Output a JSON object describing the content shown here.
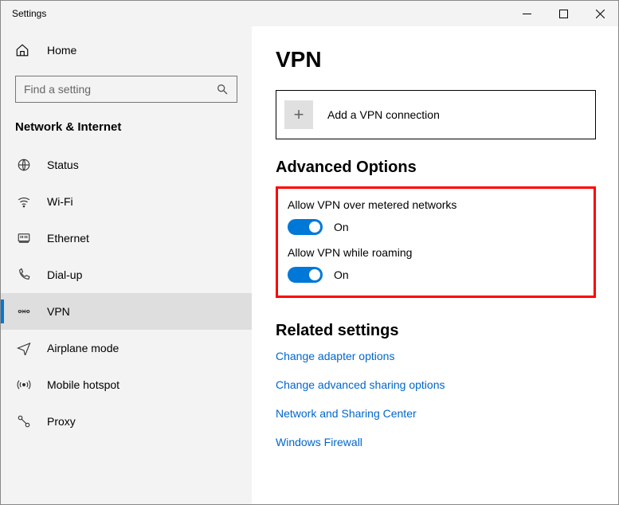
{
  "window": {
    "title": "Settings"
  },
  "sidebar": {
    "home": "Home",
    "search_placeholder": "Find a setting",
    "category": "Network & Internet",
    "items": [
      {
        "label": "Status"
      },
      {
        "label": "Wi-Fi"
      },
      {
        "label": "Ethernet"
      },
      {
        "label": "Dial-up"
      },
      {
        "label": "VPN"
      },
      {
        "label": "Airplane mode"
      },
      {
        "label": "Mobile hotspot"
      },
      {
        "label": "Proxy"
      }
    ]
  },
  "main": {
    "heading": "VPN",
    "add_label": "Add a VPN connection",
    "advanced_heading": "Advanced Options",
    "toggle1_label": "Allow VPN over metered networks",
    "toggle1_state": "On",
    "toggle2_label": "Allow VPN while roaming",
    "toggle2_state": "On",
    "related_heading": "Related settings",
    "links": [
      "Change adapter options",
      "Change advanced sharing options",
      "Network and Sharing Center",
      "Windows Firewall"
    ]
  }
}
